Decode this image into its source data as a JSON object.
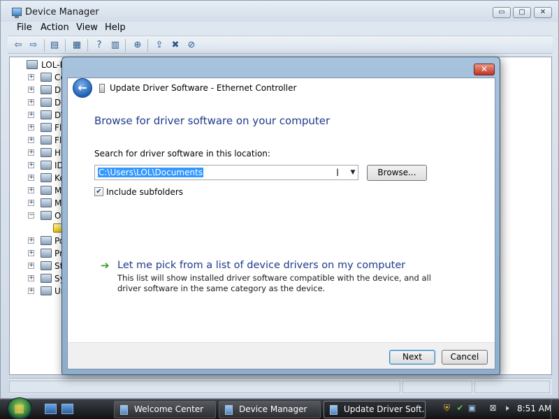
{
  "main_window": {
    "title": "Device Manager",
    "caption": {
      "minimize": "▭",
      "maximize": "▢",
      "close": "✕"
    },
    "menu": [
      "File",
      "Action",
      "View",
      "Help"
    ],
    "tree": {
      "root_label": "LOL-P",
      "items": [
        {
          "label": "Co",
          "expander": "+",
          "icon": "computer-icon"
        },
        {
          "label": "Di",
          "expander": "+",
          "icon": "disk-drive-icon"
        },
        {
          "label": "Di",
          "expander": "+",
          "icon": "display-adapter-icon"
        },
        {
          "label": "DV",
          "expander": "+",
          "icon": "dvd-drive-icon"
        },
        {
          "label": "Fl",
          "expander": "+",
          "icon": "floppy-controller-icon"
        },
        {
          "label": "Fl",
          "expander": "+",
          "icon": "floppy-drive-icon"
        },
        {
          "label": "Hu",
          "expander": "+",
          "icon": "hid-icon"
        },
        {
          "label": "ID",
          "expander": "+",
          "icon": "ide-controller-icon"
        },
        {
          "label": "Ke",
          "expander": "+",
          "icon": "keyboard-icon"
        },
        {
          "label": "M",
          "expander": "+",
          "icon": "mouse-icon"
        },
        {
          "label": "M",
          "expander": "+",
          "icon": "monitor-icon"
        },
        {
          "label": "Ot",
          "expander": "−",
          "icon": "other-devices-icon"
        },
        {
          "label": "",
          "expander": "",
          "icon": "warning-device-icon"
        },
        {
          "label": "Po",
          "expander": "+",
          "icon": "ports-icon"
        },
        {
          "label": "Pr",
          "expander": "+",
          "icon": "processor-icon"
        },
        {
          "label": "St",
          "expander": "+",
          "icon": "storage-icon"
        },
        {
          "label": "Sy",
          "expander": "+",
          "icon": "system-devices-icon"
        },
        {
          "label": "Ur",
          "expander": "+",
          "icon": "usb-icon"
        }
      ]
    }
  },
  "dialog": {
    "title": "Update Driver Software - Ethernet Controller",
    "close_glyph": "✕",
    "back_glyph": "←",
    "heading": "Browse for driver software on your computer",
    "search_label": "Search for driver software in this location:",
    "path_value": "C:\\Users\\LOL\\Documents",
    "browse_label": "Browse...",
    "include_subfolders": {
      "checked": true,
      "label": "Include subfolders",
      "check_glyph": "✔"
    },
    "pick_link": "Let me pick from a list of device drivers on my computer",
    "pick_description": "This list will show installed driver software compatible with the device, and all driver software in the same category as the device.",
    "buttons": {
      "next": "Next",
      "cancel": "Cancel"
    }
  },
  "taskbar": {
    "tasks": [
      {
        "label": "Welcome Center",
        "active": false
      },
      {
        "label": "Device Manager",
        "active": false
      },
      {
        "label": "Update Driver Soft...",
        "active": true
      }
    ],
    "clock": "8:51 AM"
  }
}
